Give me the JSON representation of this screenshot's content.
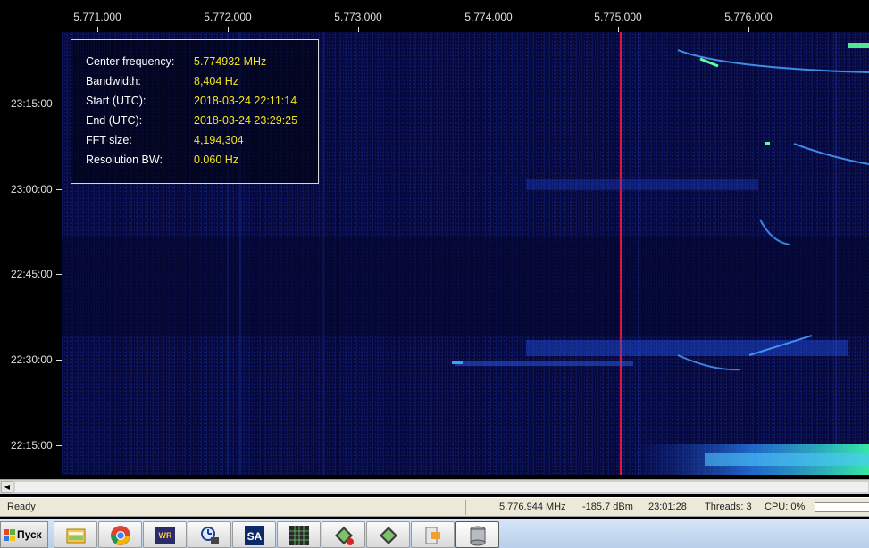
{
  "frequency_axis": {
    "ticks": [
      "5.771.000",
      "5.772.000",
      "5.773.000",
      "5.774.000",
      "5.775.000",
      "5.776.000"
    ]
  },
  "time_axis": {
    "ticks": [
      "23:15:00",
      "23:00:00",
      "22:45:00",
      "22:30:00",
      "22:15:00"
    ]
  },
  "info_panel": {
    "center_frequency": {
      "label": "Center frequency:",
      "value": "5.774932 MHz"
    },
    "bandwidth": {
      "label": "Bandwidth:",
      "value": "8,404 Hz"
    },
    "start": {
      "label": "Start (UTC):",
      "value": "2018-03-24 22:11:14"
    },
    "end": {
      "label": "End (UTC):",
      "value": "2018-03-24 23:29:25"
    },
    "fft_size": {
      "label": "FFT size:",
      "value": "4,194,304"
    },
    "resolution_bw": {
      "label": "Resolution BW:",
      "value": "0.060 Hz"
    }
  },
  "status_bar": {
    "state": "Ready",
    "cursor_frequency": "5.776.944 MHz",
    "level": "-185.7 dBm",
    "time": "23:01:28",
    "threads": "Threads: 3",
    "cpu": "CPU: 0%"
  },
  "taskbar": {
    "start_label": "Пуск",
    "apps": [
      {
        "icon": "explorer-icon"
      },
      {
        "icon": "chrome-icon"
      },
      {
        "icon": "wr-receiver-icon"
      },
      {
        "icon": "clock-tool-icon"
      },
      {
        "icon": "spectrum-analyzer-icon"
      },
      {
        "icon": "grid-tool-icon"
      },
      {
        "icon": "record-app-icon"
      },
      {
        "icon": "chip-app-icon"
      },
      {
        "icon": "plugin-app-icon"
      },
      {
        "icon": "database-icon"
      }
    ]
  },
  "colors": {
    "background": "#06093a",
    "signal_line": "#e0143c",
    "info_value": "#f4e41e",
    "accent_trace": "#4aa3ff"
  }
}
